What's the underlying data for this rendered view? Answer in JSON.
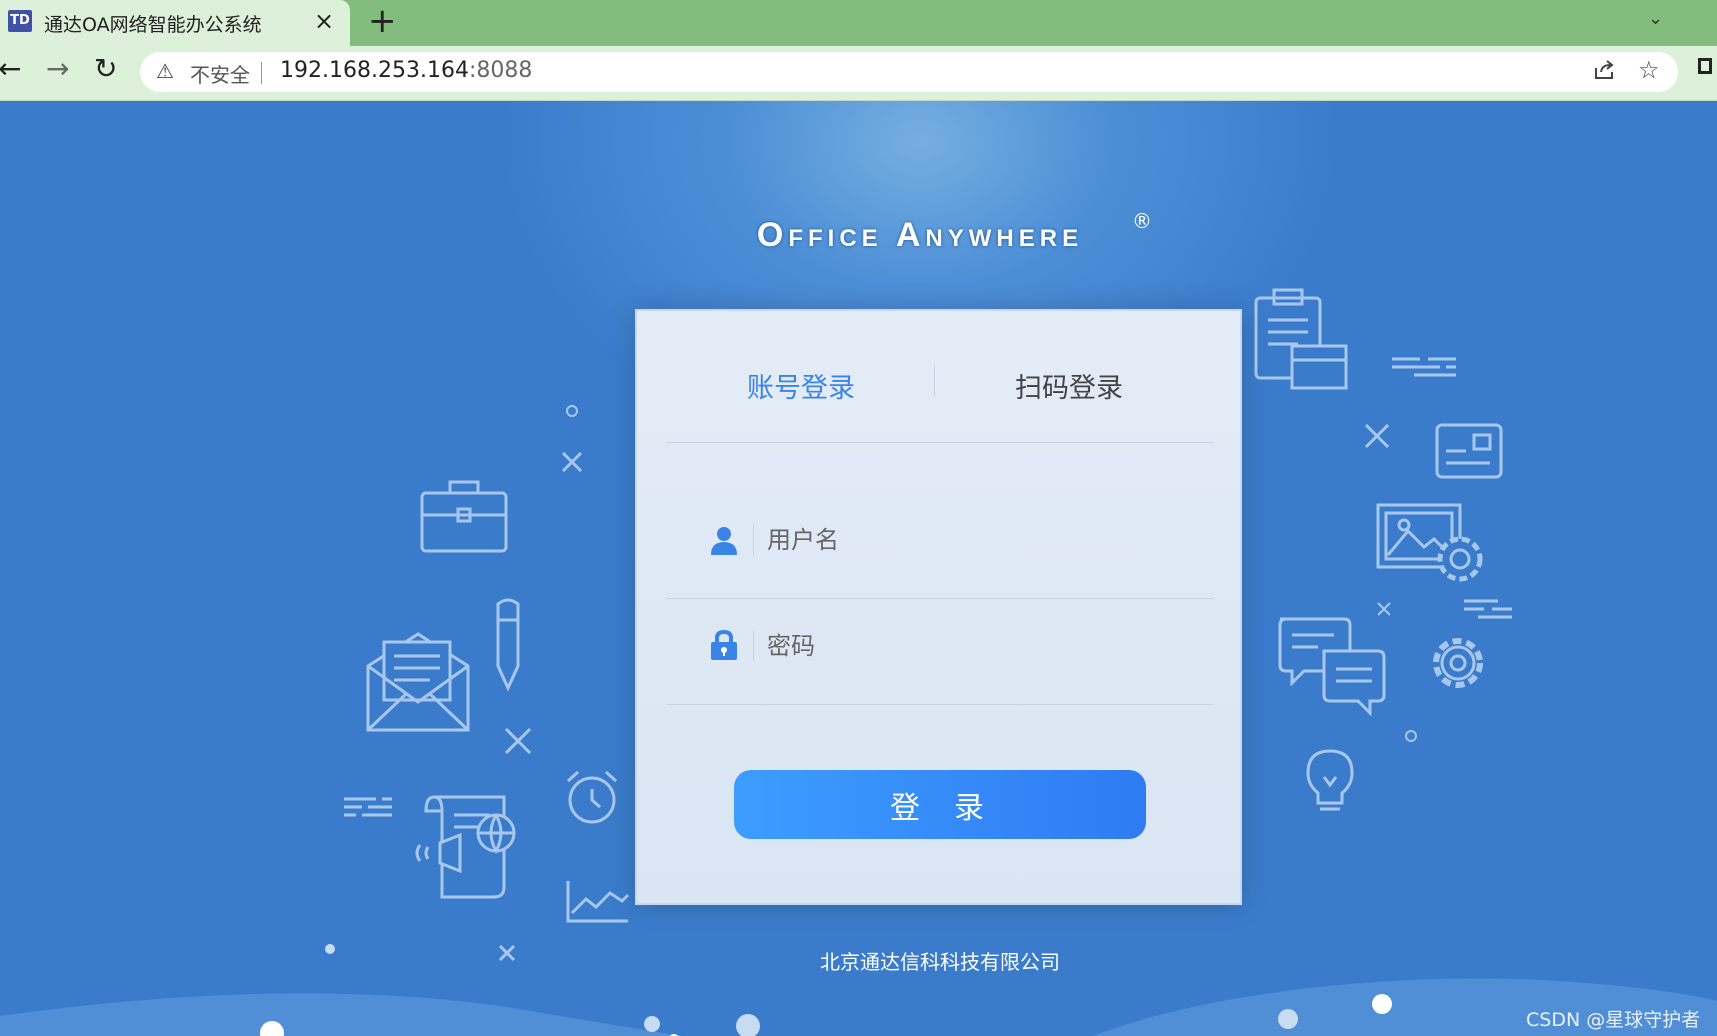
{
  "browser": {
    "tab_favicon": "TD",
    "tab_title": "通达OA网络智能办公系统",
    "tab_close": "×",
    "new_tab": "+",
    "tab_menu": "⌄",
    "back": "←",
    "forward": "→",
    "reload": "↻",
    "security_icon": "warning-triangle-icon",
    "security_label": "不安全",
    "url_host": "192.168.253.164",
    "url_port": ":8088"
  },
  "brand": {
    "title": "Office Anywhere",
    "registered": "®"
  },
  "login": {
    "tab_account": "账号登录",
    "tab_qr": "扫码登录",
    "username_placeholder": "用户名",
    "password_placeholder": "密码",
    "submit_label": "登录"
  },
  "footer": {
    "company": "北京通达信科科技有限公司"
  },
  "watermark": "CSDN @星球守护者",
  "colors": {
    "background": "#3a7ccb",
    "accent": "#3a84e8",
    "button_start": "#3d9dff",
    "button_end": "#2f7bf2"
  }
}
